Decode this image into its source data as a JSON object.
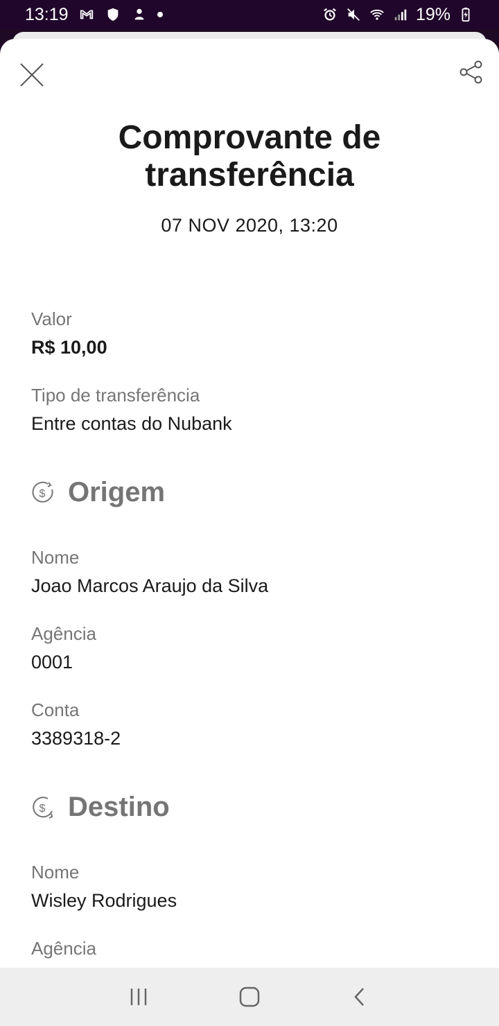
{
  "status_bar": {
    "time": "13:19",
    "battery": "19%"
  },
  "receipt": {
    "title_line1": "Comprovante de",
    "title_line2": "transferência",
    "datetime": "07 NOV 2020, 13:20",
    "valor_label": "Valor",
    "valor": "R$ 10,00",
    "tipo_label": "Tipo de transferência",
    "tipo": "Entre contas do Nubank"
  },
  "origem": {
    "section_title": "Origem",
    "nome_label": "Nome",
    "nome": "Joao Marcos Araujo da Silva",
    "agencia_label": "Agência",
    "agencia": "0001",
    "conta_label": "Conta",
    "conta": "3389318-2"
  },
  "destino": {
    "section_title": "Destino",
    "nome_label": "Nome",
    "nome": "Wisley Rodrigues",
    "agencia_label": "Agência"
  },
  "icons": {
    "close": "close-icon",
    "share": "share-icon",
    "origem": "money-out-icon",
    "destino": "money-in-icon",
    "nav_recent": "recent-apps-icon",
    "nav_home": "home-icon",
    "nav_back": "back-icon"
  },
  "colors": {
    "status_bar_bg": "#21062b",
    "label_gray": "#757575",
    "text_dark": "#1a1a1a",
    "nav_bar_bg": "#eeeeee"
  }
}
